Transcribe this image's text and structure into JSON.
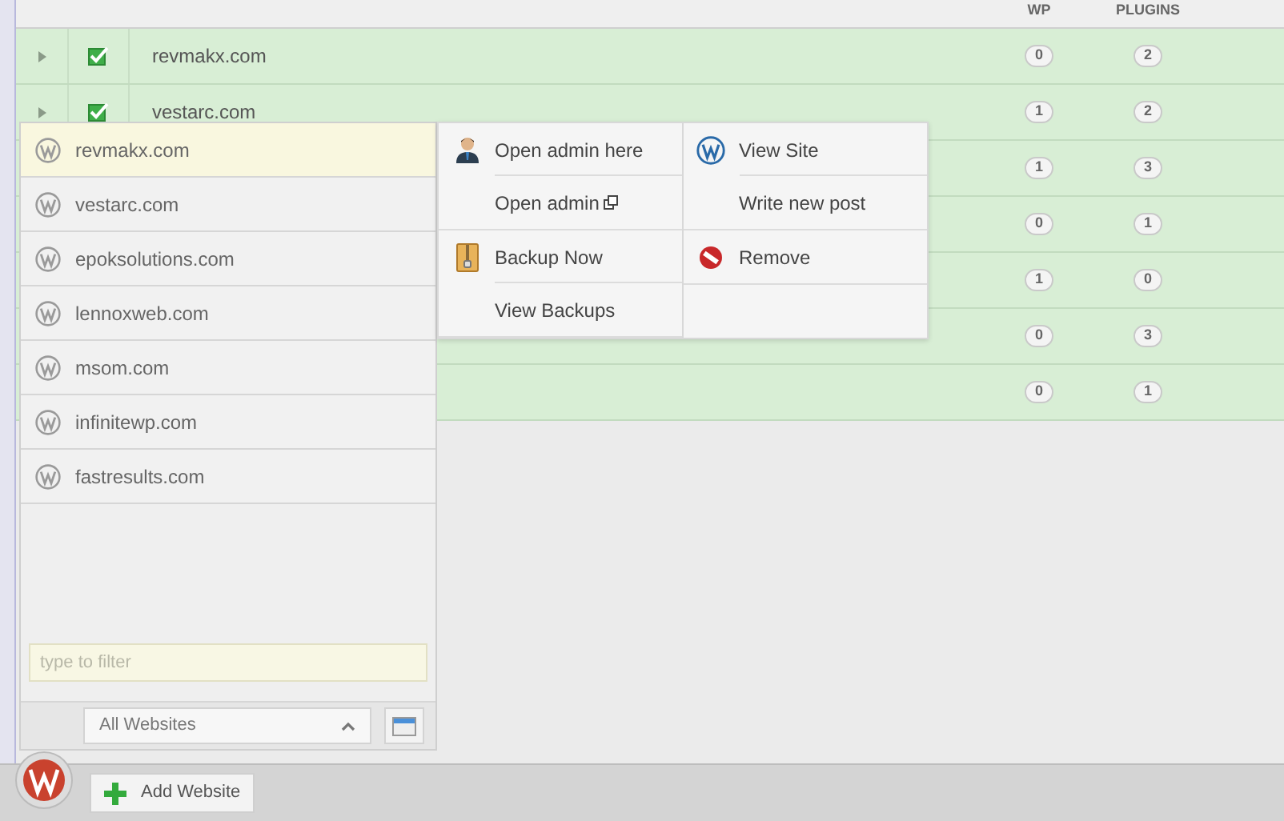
{
  "table": {
    "columns": [
      "WP",
      "PLUGINS"
    ],
    "rows": [
      {
        "name": "revmakx.com",
        "checked": true,
        "wp": "0",
        "plugins": "2"
      },
      {
        "name": "vestarc.com",
        "checked": true,
        "wp": "1",
        "plugins": "2"
      },
      {
        "wp": "1",
        "plugins": "3"
      },
      {
        "wp": "0",
        "plugins": "1"
      },
      {
        "wp": "1",
        "plugins": "0"
      },
      {
        "wp": "0",
        "plugins": "3"
      },
      {
        "wp": "0",
        "plugins": "1"
      }
    ]
  },
  "site_list": {
    "items": [
      {
        "label": "revmakx.com",
        "selected": true
      },
      {
        "label": "vestarc.com",
        "selected": false
      },
      {
        "label": "epoksolutions.com",
        "selected": false
      },
      {
        "label": "lennoxweb.com",
        "selected": false
      },
      {
        "label": "msom.com",
        "selected": false
      },
      {
        "label": "infinitewp.com",
        "selected": false
      },
      {
        "label": "fastresults.com",
        "selected": false
      }
    ],
    "filter": {
      "placeholder": "type to filter"
    },
    "group_select": {
      "value": "All Websites"
    }
  },
  "context_menu": {
    "columns": [
      [
        [
          {
            "label": "Open admin here",
            "kind": "user"
          },
          {
            "label": "Open admin",
            "kind": "external"
          }
        ],
        [
          {
            "label": "Backup Now",
            "kind": "archive"
          },
          {
            "label": "View Backups",
            "kind": "plain"
          }
        ]
      ],
      [
        [
          {
            "label": "View Site",
            "kind": "wordpress"
          },
          {
            "label": "Write new post",
            "kind": "plain"
          }
        ],
        [
          {
            "label": "Remove",
            "kind": "remove"
          }
        ]
      ]
    ]
  },
  "bottom_bar": {
    "add_button": "Add Website"
  }
}
